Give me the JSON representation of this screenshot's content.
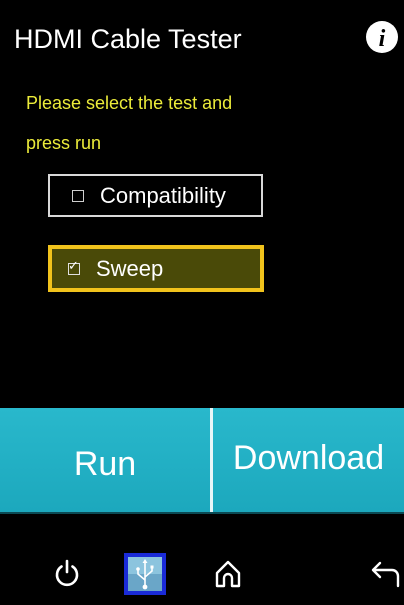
{
  "header": {
    "title": "HDMI Cable Tester",
    "info_icon": "info-icon"
  },
  "prompt": {
    "line1": "Please select the test and",
    "line2": "press run"
  },
  "options": [
    {
      "label": "Compatibility",
      "checked": false,
      "selected": false
    },
    {
      "label": "Sweep",
      "checked": true,
      "selected": true
    }
  ],
  "actions": {
    "run_label": "Run",
    "download_label": "Download"
  },
  "nav": {
    "icons": [
      "power-icon",
      "usb-icon",
      "home-icon",
      "back-arrow-icon"
    ]
  },
  "colors": {
    "background": "#000000",
    "prompt_text": "#ecec3a",
    "button_teal": "#1ca8bd",
    "selected_border": "#f1c31c",
    "usb_highlight": "#1a2bd8"
  }
}
